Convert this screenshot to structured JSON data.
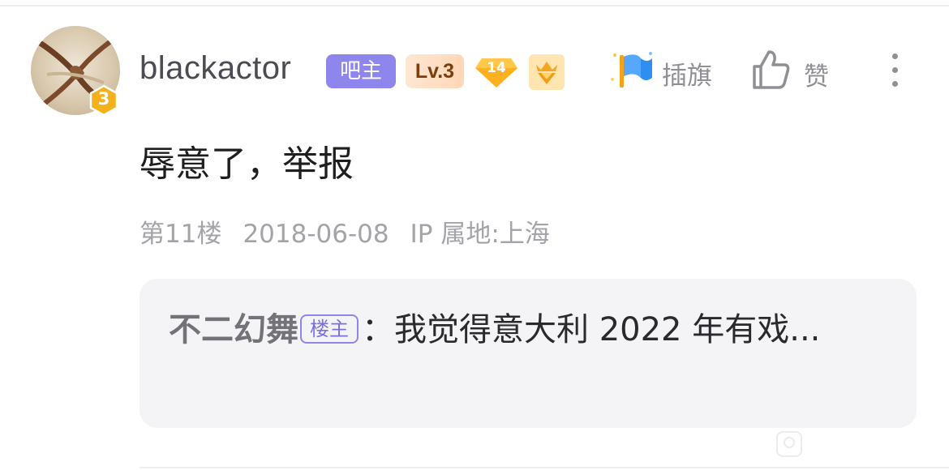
{
  "post": {
    "author": {
      "username": "blackactor",
      "avatar_level": "3",
      "role_badge": "吧主",
      "level_badge": "Lv.3",
      "gem_badge": "14",
      "vip_badge_icon": "crown-gem-icon"
    },
    "actions": {
      "flag_label": "插旗",
      "like_label": "赞",
      "more_icon": "more-vertical-icon"
    },
    "content": "辱意了，举报",
    "meta": {
      "floor": "第11楼",
      "date": "2018-06-08",
      "ip_location": "IP 属地:上海"
    },
    "reply": {
      "author": "不二幻舞",
      "op_tag": "楼主",
      "separator": "：",
      "text": "我觉得意大利 2022 年有戏..."
    }
  },
  "colors": {
    "accent_purple": "#8e86ec",
    "muted_text": "#a3a3aa",
    "reply_bg": "#f4f4f6"
  }
}
